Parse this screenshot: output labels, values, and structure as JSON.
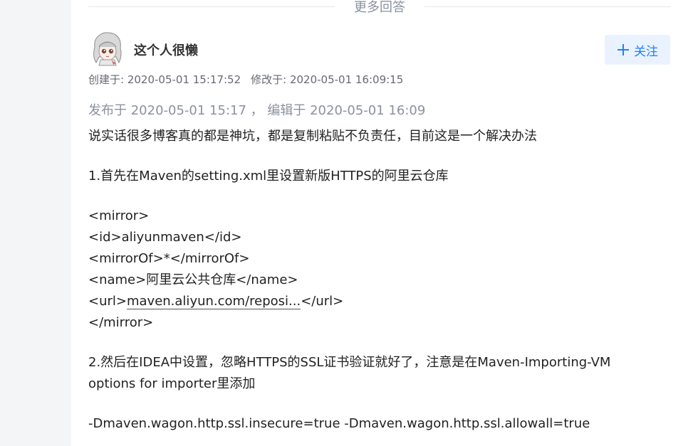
{
  "divider": {
    "label": "更多回答"
  },
  "user": {
    "name": "这个人很懒",
    "avatar": "avatar-illustration"
  },
  "follow": {
    "label": "关注",
    "icon": "plus-icon",
    "color": "#1e80ff",
    "bg": "#eaf2ff"
  },
  "meta": {
    "created": "创建于: 2020-05-01 15:17:52",
    "modified": "修改于: 2020-05-01 16:09:15"
  },
  "publish": {
    "text": "发布于 2020-05-01 15:17 ， 编辑于 2020-05-01 16:09"
  },
  "answer": {
    "intro": "说实话很多博客真的都是神坑，都是复制粘贴不负责任，目前这是一个解决办法",
    "step1": "1.首先在Maven的setting.xml里设置新版HTTPS的阿里云仓库",
    "code": {
      "mirror_open": "<mirror>",
      "id": "<id>aliyunmaven</id>",
      "mirrorOf": "<mirrorOf>*</mirrorOf>",
      "name": "<name>阿里云公共仓库</name>",
      "url_open": "<url>",
      "url_link": "maven.aliyun.com/reposi...",
      "url_close": "</url>",
      "mirror_close": "</mirror>"
    },
    "step2": "2.然后在IDEA中设置，忽略HTTPS的SSL证书验证就好了，注意是在Maven-Importing-VM options for importer里添加",
    "option": "-Dmaven.wagon.http.ssl.insecure=true -Dmaven.wagon.http.ssl.allowall=true"
  }
}
